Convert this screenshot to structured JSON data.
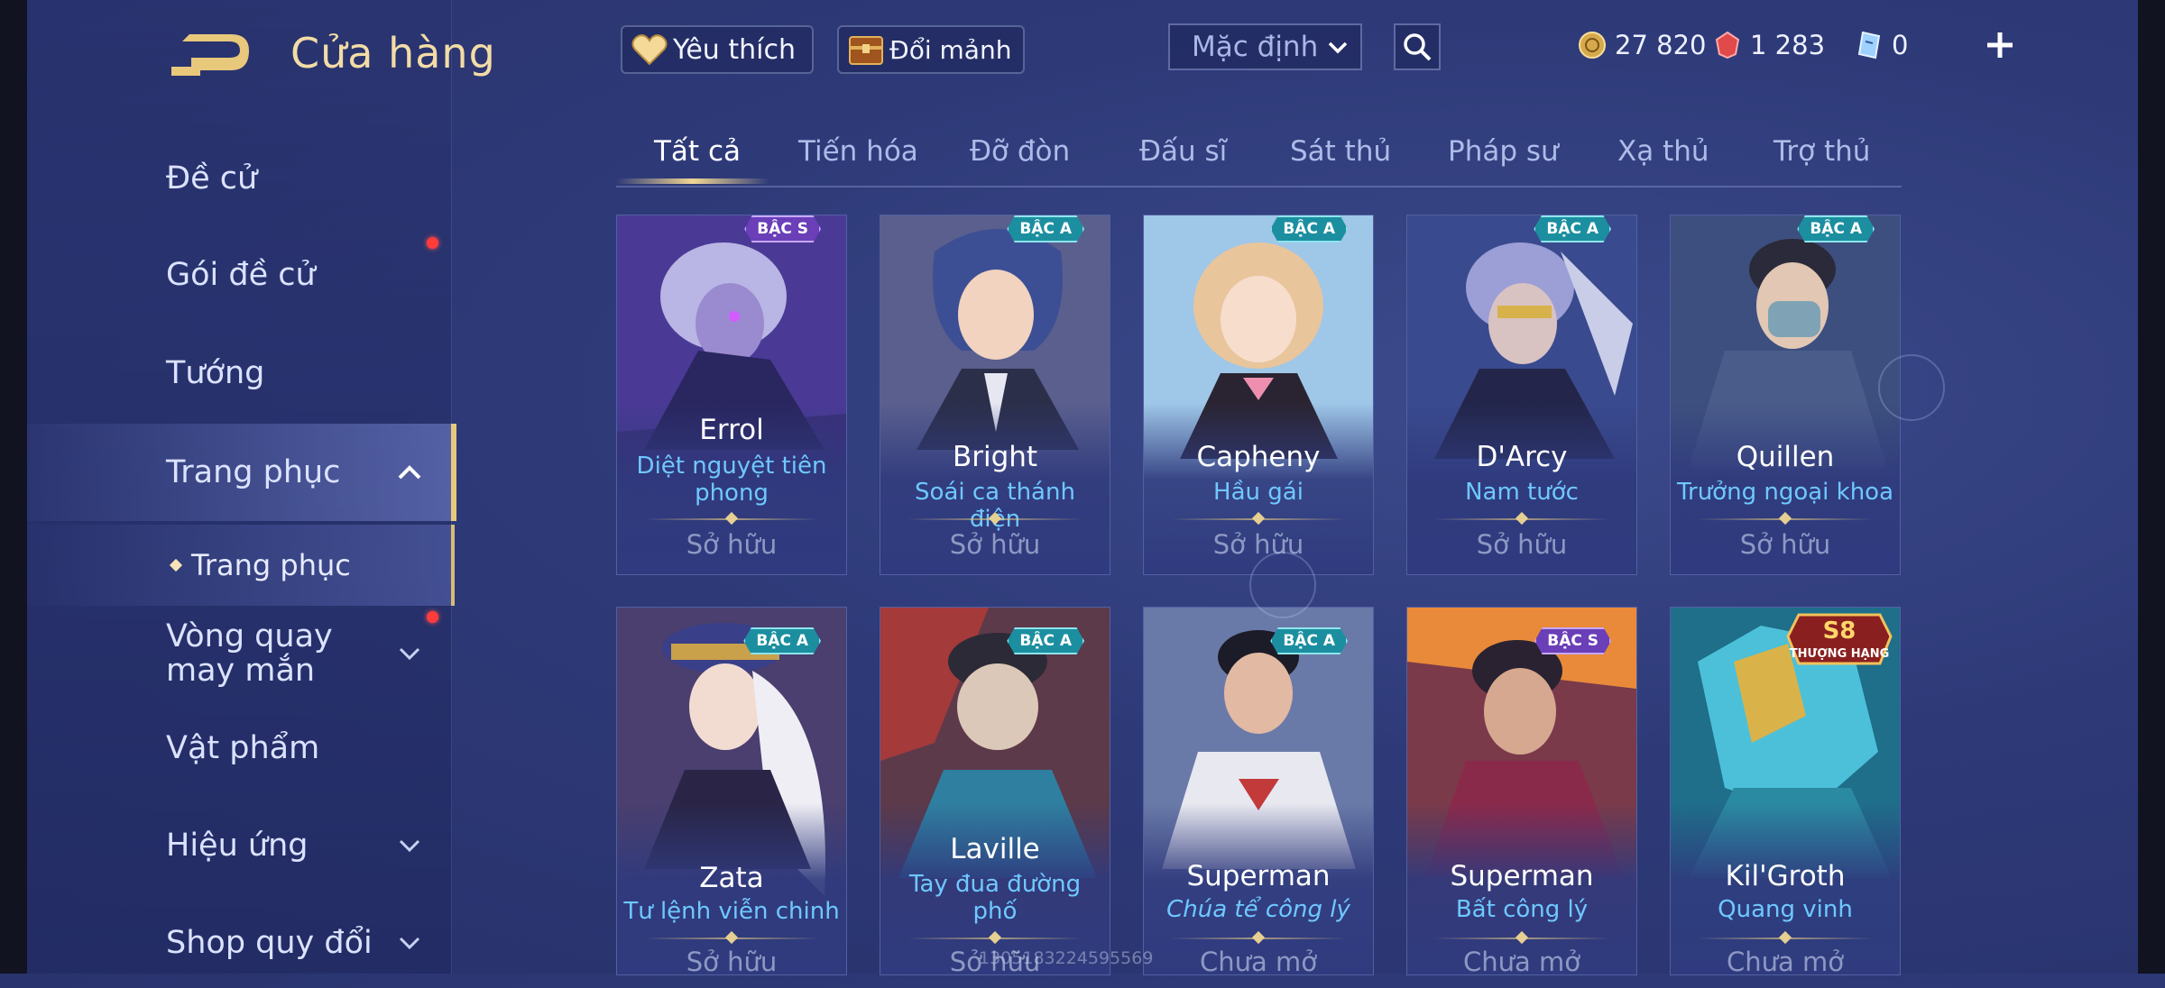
{
  "header": {
    "title": "Cửa hàng",
    "favorite_label": "Yêu thích",
    "exchange_label": "Đổi mảnh",
    "sort_value": "Mặc định",
    "currencies": [
      {
        "icon": "gold-coin-icon",
        "value": "27 820"
      },
      {
        "icon": "red-gem-icon",
        "value": "1 283"
      },
      {
        "icon": "blue-voucher-icon",
        "value": "0"
      }
    ]
  },
  "sidebar": {
    "items": [
      {
        "label": "Đề cử"
      },
      {
        "label": "Gói đề cử"
      },
      {
        "label": "Tướng"
      },
      {
        "label": "Trang phục"
      },
      {
        "label": "Trang phục"
      },
      {
        "label": "Vòng quay may mắn"
      },
      {
        "label": "Vật phẩm"
      },
      {
        "label": "Hiệu ứng"
      },
      {
        "label": "Shop quy đổi"
      }
    ]
  },
  "tabs": [
    "Tất cả",
    "Tiến hóa",
    "Đỡ đòn",
    "Đấu sĩ",
    "Sát thủ",
    "Pháp sư",
    "Xạ thủ",
    "Trợ thủ"
  ],
  "colors": {
    "accent_gold": "#f3dca6",
    "skin_name_blue": "#6fc8ff",
    "rank_a_teal": "#1b8fa0",
    "rank_s_purple": "#6a3fb8",
    "notification_red": "#ff3b3b"
  },
  "cards": [
    {
      "rank": "BẬC S",
      "hero": "Errol",
      "skin": "Diệt nguyệt tiên phong",
      "status": "Sở hữu"
    },
    {
      "rank": "BẬC A",
      "hero": "Bright",
      "skin": "Soái ca thánh điện",
      "status": "Sở hữu"
    },
    {
      "rank": "BẬC A",
      "hero": "Capheny",
      "skin": "Hầu gái",
      "status": "Sở hữu"
    },
    {
      "rank": "BẬC A",
      "hero": "D'Arcy",
      "skin": "Nam tước",
      "status": "Sở hữu"
    },
    {
      "rank": "BẬC A",
      "hero": "Quillen",
      "skin": "Trưởng ngoại khoa",
      "status": "Sở hữu"
    },
    {
      "rank": "BẬC A",
      "hero": "Zata",
      "skin": "Tư lệnh viễn chinh",
      "status": "Sở hữu"
    },
    {
      "rank": "BẬC A",
      "hero": "Laville",
      "skin": "Tay đua đường phố",
      "status": "Sở hữu"
    },
    {
      "rank": "BẬC A",
      "hero": "Superman",
      "skin": "Chúa tể công lý",
      "status": "Chưa mở"
    },
    {
      "rank": "BẬC S",
      "hero": "Superman",
      "skin": "Bất công lý",
      "status": "Chưa mở"
    },
    {
      "rank": "",
      "badge": "S8 THƯỢNG HẠNG",
      "hero": "Kil'Groth",
      "skin": "Quang vinh",
      "status": "Chưa mở"
    }
  ],
  "watermark": "1305183224595569"
}
